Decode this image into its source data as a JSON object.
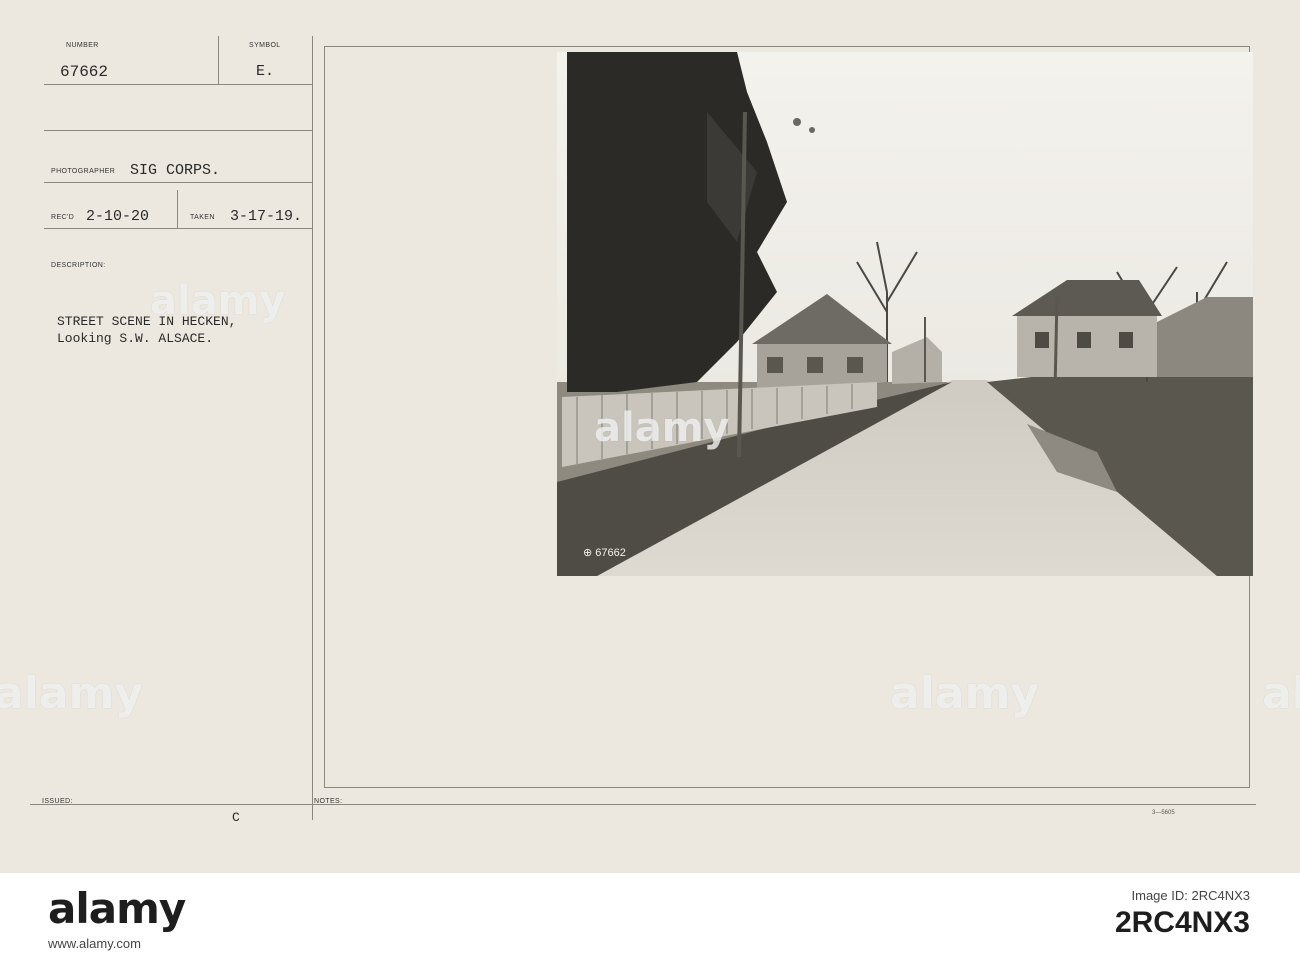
{
  "record": {
    "number_label": "NUMBER",
    "number": "67662",
    "symbol_label": "SYMBOL",
    "symbol": "E.",
    "photographer_label": "PHOTOGRAPHER",
    "photographer": "SIG CORPS.",
    "recd_label": "REC'D",
    "recd": "2-10-20",
    "taken_label": "TAKEN",
    "taken": "3-17-19.",
    "description_label": "DESCRIPTION:",
    "description_line1": "STREET SCENE IN HECKEN,",
    "description_line2": "Looking S.W. ALSACE.",
    "issued_label": "ISSUED:",
    "issued_mark": "C",
    "notes_label": "NOTES:",
    "form_code": "3—5605"
  },
  "photo": {
    "negative_number": "⊕ 67662"
  },
  "watermark": {
    "text": "alamy"
  },
  "footer": {
    "logo": "alamy",
    "image_id_label": "Image ID: 2RC4NX3",
    "url": "www.alamy.com",
    "image_id": "2RC4NX3"
  },
  "colors": {
    "card": "#ece8df",
    "ink": "#2a2a2a",
    "rule": "#8a877f"
  }
}
